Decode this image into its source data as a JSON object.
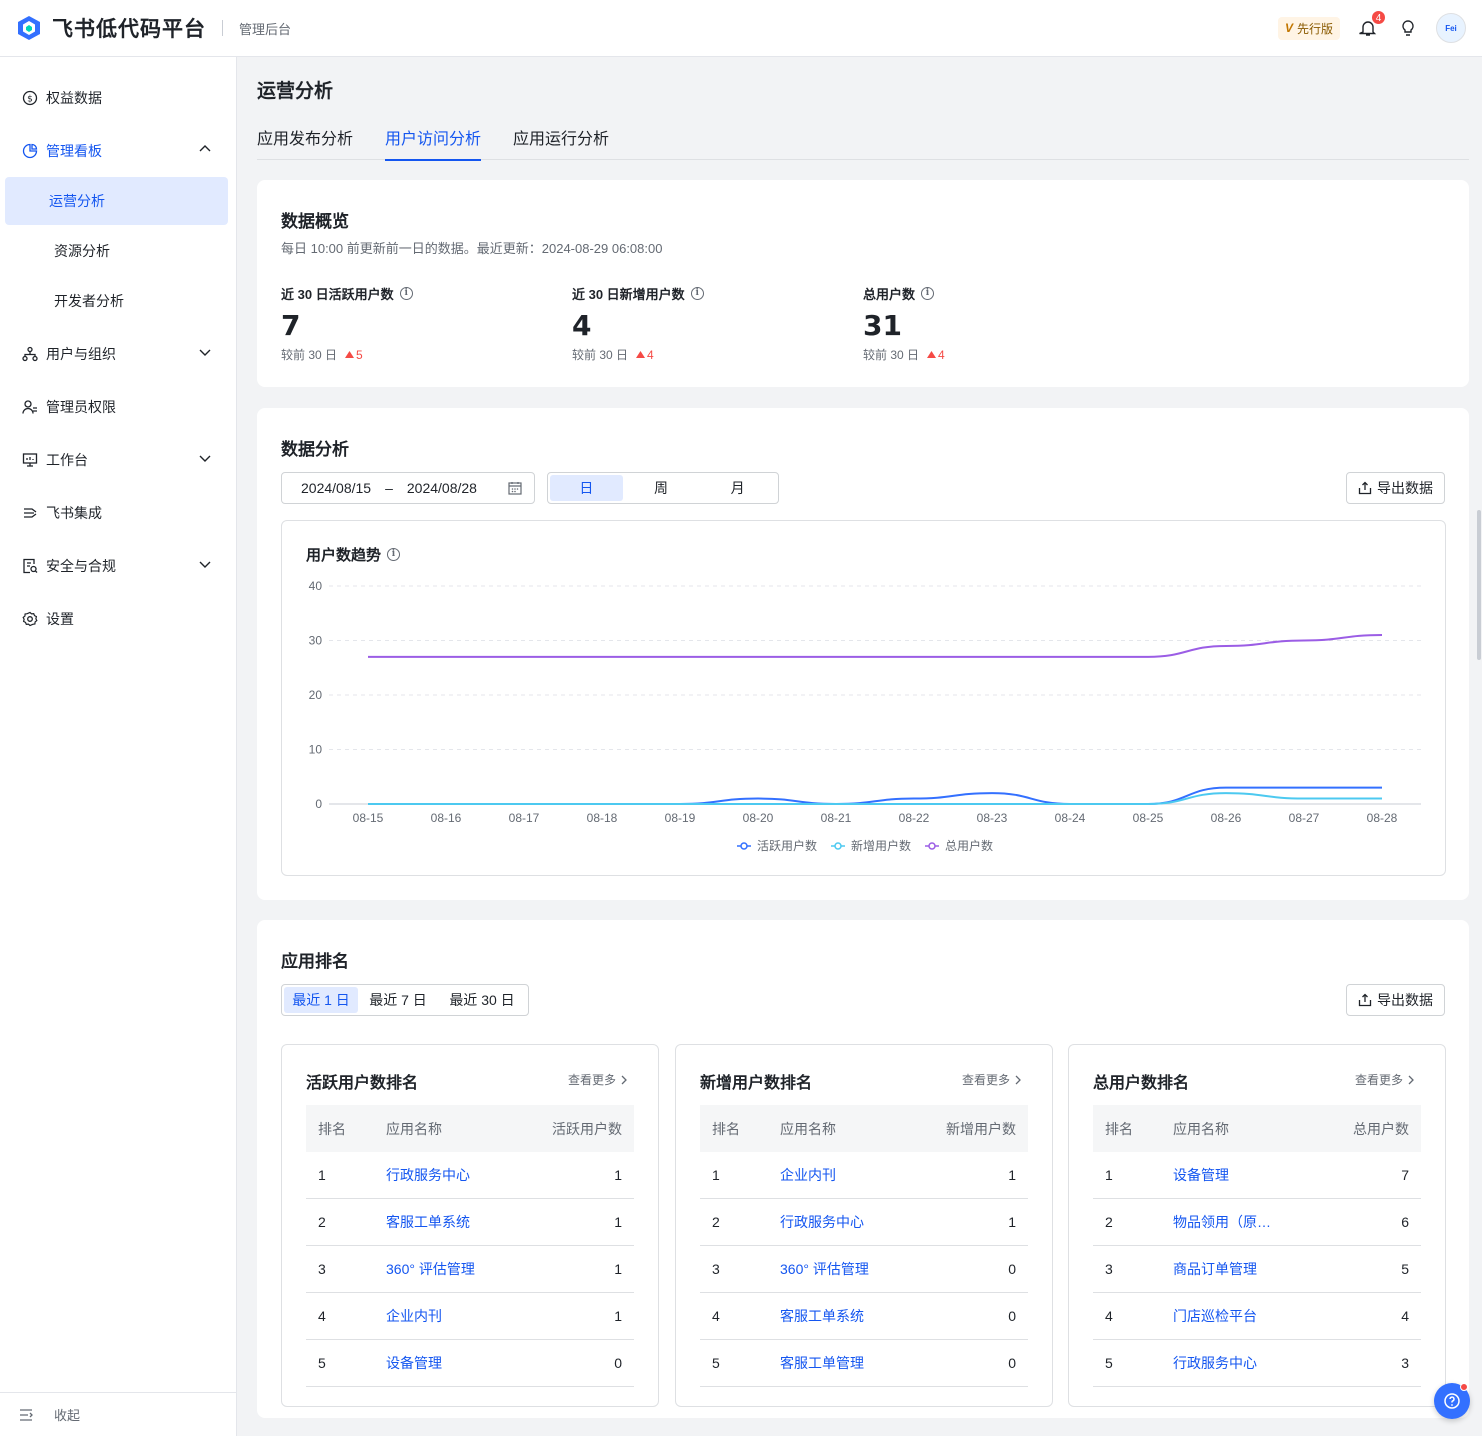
{
  "header": {
    "brand": "飞书低代码平台",
    "sub": "管理后台",
    "version_badge": "先行版",
    "notif_count": "4",
    "avatar_text": "Fei"
  },
  "sidebar": {
    "items": [
      {
        "label": "权益数据",
        "icon": "dollar-icon"
      },
      {
        "label": "管理看板",
        "icon": "pie-chart-icon"
      },
      {
        "label": "用户与组织",
        "icon": "org-icon"
      },
      {
        "label": "管理员权限",
        "icon": "admin-user-icon"
      },
      {
        "label": "工作台",
        "icon": "monitor-icon"
      },
      {
        "label": "飞书集成",
        "icon": "integration-icon"
      },
      {
        "label": "安全与合规",
        "icon": "security-doc-icon"
      },
      {
        "label": "设置",
        "icon": "gear-icon"
      }
    ],
    "sub_items": [
      "运营分析",
      "资源分析",
      "开发者分析"
    ],
    "collapse": "收起"
  },
  "page": {
    "title": "运营分析",
    "tabs": [
      "应用发布分析",
      "用户访问分析",
      "应用运行分析"
    ]
  },
  "overview": {
    "title": "数据概览",
    "desc": "每日 10:00 前更新前一日的数据。最近更新：2024-08-29 06:08:00",
    "metrics": [
      {
        "label": "近 30 日活跃用户数",
        "value": "7",
        "cmp": "较前 30 日",
        "delta": "5"
      },
      {
        "label": "近 30 日新增用户数",
        "value": "4",
        "cmp": "较前 30 日",
        "delta": "4"
      },
      {
        "label": "总用户数",
        "value": "31",
        "cmp": "较前 30 日",
        "delta": "4"
      }
    ]
  },
  "analysis": {
    "title": "数据分析",
    "date_start": "2024/08/15",
    "date_sep": "–",
    "date_end": "2024/08/28",
    "periods": [
      "日",
      "周",
      "月"
    ],
    "export": "导出数据",
    "chart_title": "用户数趋势"
  },
  "chart_data": {
    "type": "line",
    "x": [
      "08-15",
      "08-16",
      "08-17",
      "08-18",
      "08-19",
      "08-20",
      "08-21",
      "08-22",
      "08-23",
      "08-24",
      "08-25",
      "08-26",
      "08-27",
      "08-28"
    ],
    "ylim": [
      0,
      40
    ],
    "yticks": [
      0,
      10,
      20,
      30,
      40
    ],
    "grid": true,
    "legend_position": "bottom",
    "series": [
      {
        "name": "活跃用户数",
        "color": "#3370ff",
        "values": [
          0,
          0,
          0,
          0,
          0,
          1,
          0,
          1,
          2,
          0,
          0,
          3,
          3,
          3
        ]
      },
      {
        "name": "新增用户数",
        "color": "#4cc9f0",
        "values": [
          0,
          0,
          0,
          0,
          0,
          0,
          0,
          0,
          0,
          0,
          0,
          2,
          1,
          1
        ]
      },
      {
        "name": "总用户数",
        "color": "#9b5de5",
        "values": [
          27,
          27,
          27,
          27,
          27,
          27,
          27,
          27,
          27,
          27,
          27,
          29,
          30,
          31
        ]
      }
    ]
  },
  "ranking": {
    "title": "应用排名",
    "periods": [
      "最近 1 日",
      "最近 7 日",
      "最近 30 日"
    ],
    "export": "导出数据",
    "more": "查看更多",
    "col_rank": "排名",
    "col_name": "应用名称",
    "tables": [
      {
        "title": "活跃用户数排名",
        "metric": "活跃用户数",
        "rows": [
          {
            "rank": "1",
            "name": "行政服务中心",
            "value": "1"
          },
          {
            "rank": "2",
            "name": "客服工单系统",
            "value": "1"
          },
          {
            "rank": "3",
            "name": "360° 评估管理",
            "value": "1"
          },
          {
            "rank": "4",
            "name": "企业内刊",
            "value": "1"
          },
          {
            "rank": "5",
            "name": "设备管理",
            "value": "0"
          }
        ]
      },
      {
        "title": "新增用户数排名",
        "metric": "新增用户数",
        "rows": [
          {
            "rank": "1",
            "name": "企业内刊",
            "value": "1"
          },
          {
            "rank": "2",
            "name": "行政服务中心",
            "value": "1"
          },
          {
            "rank": "3",
            "name": "360° 评估管理",
            "value": "0"
          },
          {
            "rank": "4",
            "name": "客服工单系统",
            "value": "0"
          },
          {
            "rank": "5",
            "name": "客服工单管理",
            "value": "0"
          }
        ]
      },
      {
        "title": "总用户数排名",
        "metric": "总用户数",
        "rows": [
          {
            "rank": "1",
            "name": "设备管理",
            "value": "7"
          },
          {
            "rank": "2",
            "name": "物品领用（原…",
            "value": "6"
          },
          {
            "rank": "3",
            "name": "商品订单管理",
            "value": "5"
          },
          {
            "rank": "4",
            "name": "门店巡检平台",
            "value": "4"
          },
          {
            "rank": "5",
            "name": "行政服务中心",
            "value": "3"
          }
        ]
      }
    ]
  }
}
